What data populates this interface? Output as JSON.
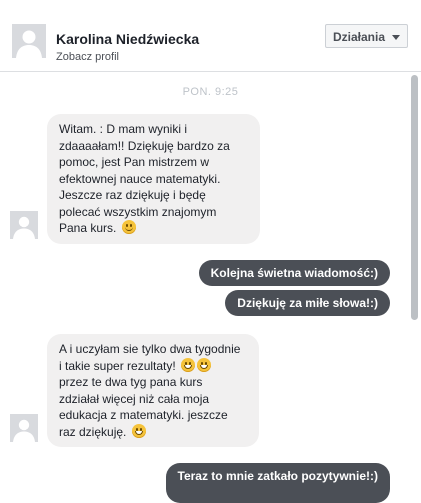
{
  "header": {
    "contact_name": "Karolina Niedźwiecka",
    "profile_link": "Zobacz profil",
    "actions_label": "Działania"
  },
  "conversation": {
    "timestamp": "PON. 9:25",
    "messages": [
      {
        "direction": "incoming",
        "text": "Witam. : D mam wyniki i\nzdaaaałam!! Dziękuję bardzo za\npomoc, jest Pan mistrzem w\nefektownej nauce matematyki.\nJeszcze raz dziękuję i będę\npolecać wszystkim znajomym\nPana kurs.",
        "emoji": [
          "slightly-smiling-face"
        ]
      },
      {
        "direction": "outgoing",
        "text": "Kolejna świetna wiadomość:)"
      },
      {
        "direction": "outgoing",
        "text": "Dziękuję za miłe słowa!:)"
      },
      {
        "direction": "incoming",
        "text_a": "A i uczyłam sie tylko dwa tygodnie\ni takie super rezultaty!",
        "text_b": "\nprzez te dwa tyg pana kurs\nzdziałał więcej niż cała moja\nedukacja z matematyki. jeszcze\nraz dziękuję.",
        "emoji_a": [
          "grinning-face",
          "grinning-face"
        ],
        "emoji_b": [
          "grinning-face"
        ]
      },
      {
        "direction": "outgoing",
        "text": "Teraz to mnie zatkało pozytywnie!:)"
      }
    ]
  },
  "colors": {
    "incoming_bubble": "#f1f0f0",
    "outgoing_bubble": "#4b4f56",
    "timestamp": "#bec3c9"
  }
}
